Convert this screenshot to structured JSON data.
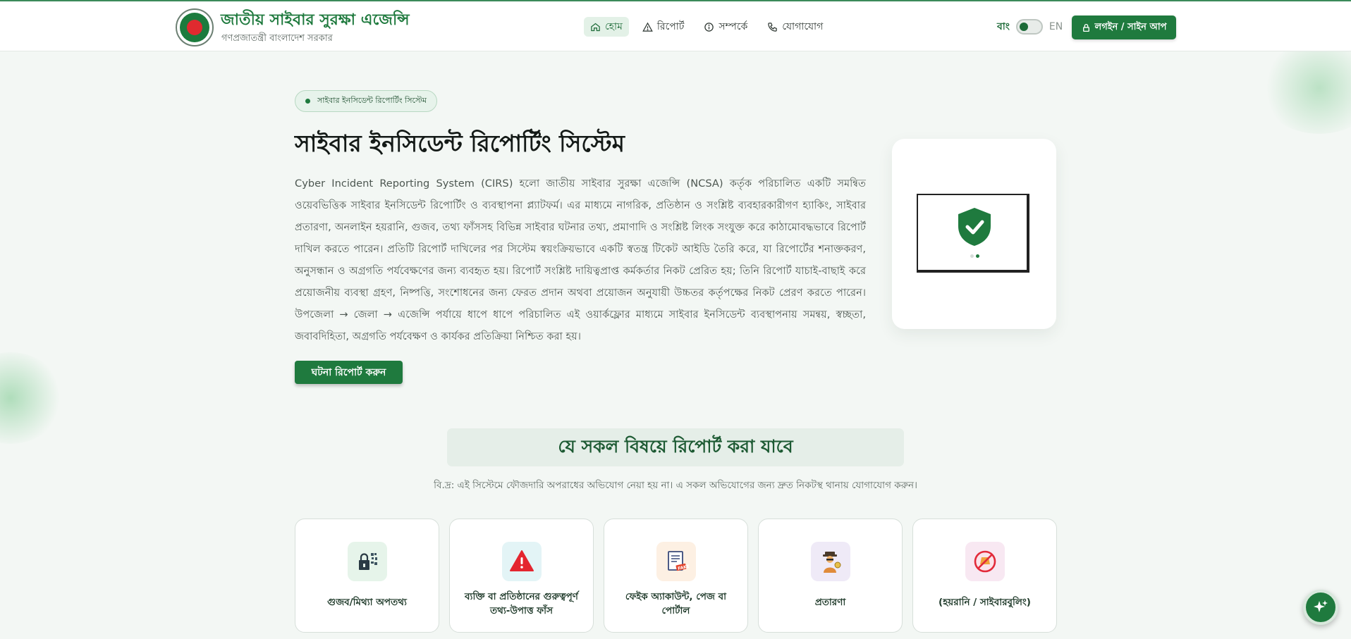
{
  "header": {
    "title": "জাতীয় সাইবার সুরক্ষা এজেন্সি",
    "subtitle": "গণপ্রজাতন্ত্রী বাংলাদেশ সরকার",
    "nav": [
      {
        "label": "হোম",
        "icon": "home-icon",
        "active": true
      },
      {
        "label": "রিপোর্ট",
        "icon": "warning-icon",
        "active": false
      },
      {
        "label": "সম্পর্কে",
        "icon": "info-icon",
        "active": false
      },
      {
        "label": "যোগাযোগ",
        "icon": "phone-icon",
        "active": false
      }
    ],
    "lang_bn": "বাং",
    "lang_en": "EN",
    "login_label": "লগইন / সাইন আপ"
  },
  "hero": {
    "badge": "সাইবার ইনসিডেন্ট রিপোর্টিং সিস্টেম",
    "title": "সাইবার ইনসিডেন্ট রিপোর্টিং সিস্টেম",
    "description": "Cyber Incident Reporting System (CIRS) হলো জাতীয় সাইবার সুরক্ষা এজেন্সি (NCSA) কর্তৃক পরিচালিত একটি সমন্বিত ওয়েবভিত্তিক সাইবার ইনসিডেন্ট রিপোর্টিং ও ব্যবস্থাপনা প্ল্যাটফর্ম। এর মাধ্যমে নাগরিক, প্রতিষ্ঠান ও সংশ্লিষ্ট ব্যবহারকারীগণ হ্যাকিং, সাইবার প্রতারণা, অনলাইন হয়রানি, গুজব, তথ্য ফাঁসসহ বিভিন্ন সাইবার ঘটনার তথ্য, প্রমাণাদি ও সংশ্লিষ্ট লিংক সংযুক্ত করে কাঠামোবদ্ধভাবে রিপোর্ট দাখিল করতে পারেন। প্রতিটি রিপোর্ট দাখিলের পর সিস্টেম স্বয়ংক্রিয়ভাবে একটি স্বতন্ত্র টিকেট আইডি তৈরি করে, যা রিপোর্টের শনাক্তকরণ, অনুসন্ধান ও অগ্রগতি পর্যবেক্ষণের জন্য ব্যবহৃত হয়। রিপোর্ট সংশ্লিষ্ট দায়িত্বপ্রাপ্ত কর্মকর্তার নিকট প্রেরিত হয়; তিনি রিপোর্ট যাচাই-বাছাই করে প্রয়োজনীয় ব্যবস্থা গ্রহণ, নিষ্পত্তি, সংশোধনের জন্য ফেরত প্রদান অথবা প্রয়োজন অনুযায়ী উচ্চতর কর্তৃপক্ষের নিকট প্রেরণ করতে পারেন। উপজেলা → জেলা → এজেন্সি পর্যায়ে ধাপে ধাপে পরিচালিত এই ওয়ার্কফ্লোর মাধ্যমে সাইবার ইনসিডেন্ট ব্যবস্থাপনায় সমন্বয়, স্বচ্ছতা, জবাবদিহিতা, অগ্রগতি পর্যবেক্ষণ ও কার্যকর প্রতিক্রিয়া নিশ্চিত করা হয়।",
    "cta_label": "ঘটনা রিপোর্ট করুন"
  },
  "categories": {
    "title": "যে সকল বিষয়ে রিপোর্ট করা যাবে",
    "note": "বি.দ্র: এই সিস্টেমে ফৌজদারি অপরাধের অভিযোগ নেয়া হয় না। এ সকল অভিযোগের জন্য দ্রুত নিকটস্থ থানায় যোগাযোগ করুন।",
    "items": [
      {
        "label": "গুজব/মিথ্যা অপতথ্য",
        "icon": "lock-qr-icon",
        "bg": "#e6f4ea"
      },
      {
        "label": "ব্যক্তি বা প্রতিষ্ঠানের গুরুত্বপূর্ণ তথ্য-উপাত্ত ফাঁস",
        "icon": "alert-triangle-icon",
        "bg": "#e3f4f6"
      },
      {
        "label": "ফেইক অ্যাকাউন্ট, পেজ বা পোর্টাল",
        "icon": "fake-document-icon",
        "bg": "#fdf0e3"
      },
      {
        "label": "প্রতারণা",
        "icon": "scammer-icon",
        "bg": "#efeaf7"
      },
      {
        "label": "(হয়রানি / সাইবারবুলিং)",
        "icon": "no-bullying-icon",
        "bg": "#f8e8f2"
      }
    ]
  },
  "colors": {
    "brand": "#1f7a3e",
    "accent_bg": "#e5eee8"
  },
  "fab_icon": "sparkle-icon"
}
